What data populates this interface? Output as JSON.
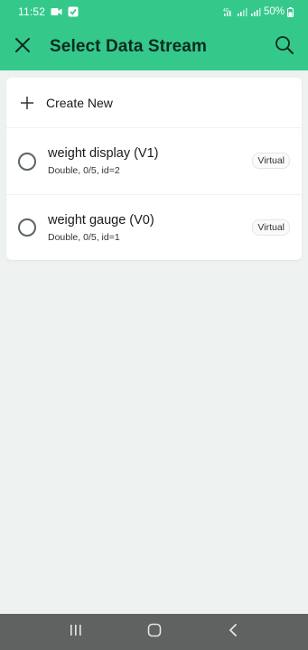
{
  "status_bar": {
    "time": "11:52",
    "battery_percent": "50%",
    "icons": [
      "video-call-icon",
      "check-square-icon",
      "wifi-signal-icon",
      "cellular-signal-icon",
      "cellular-signal-icon",
      "battery-icon"
    ]
  },
  "app_bar": {
    "title": "Select Data Stream",
    "close_icon": "close-icon",
    "search_icon": "search-icon"
  },
  "list": {
    "create_new_label": "Create New",
    "streams": [
      {
        "name": "weight display (V1)",
        "meta": "Double, 0/5, id=2",
        "badge": "Virtual",
        "selected": false
      },
      {
        "name": "weight gauge (V0)",
        "meta": "Double, 0/5, id=1",
        "badge": "Virtual",
        "selected": false
      }
    ]
  },
  "nav_bar": {
    "icons": [
      "recent-apps-icon",
      "home-icon",
      "back-icon"
    ]
  },
  "colors": {
    "accent": "#34c98b",
    "title_text": "#0d2a20",
    "background": "#edf2f0",
    "nav_bar": "#5f6261"
  }
}
